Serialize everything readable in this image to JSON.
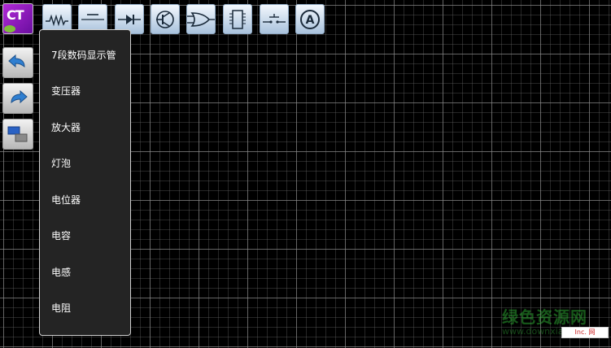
{
  "app": {
    "logo_text": "CT"
  },
  "sidebar": {
    "buttons": [
      {
        "icon": "undo-icon"
      },
      {
        "icon": "redo-icon"
      },
      {
        "icon": "layers-icon"
      }
    ]
  },
  "toolbar": {
    "tools": [
      {
        "icon": "resistor-icon"
      },
      {
        "icon": "capacitor-icon"
      },
      {
        "icon": "diode-icon"
      },
      {
        "icon": "transistor-icon"
      },
      {
        "icon": "or-gate-icon"
      },
      {
        "icon": "ic-chip-icon"
      },
      {
        "icon": "switch-icon"
      },
      {
        "icon": "ammeter-icon",
        "label": "A"
      }
    ]
  },
  "menu": {
    "items": [
      "7段数码显示管",
      "变压器",
      "放大器",
      "灯泡",
      "电位器",
      "电容",
      "电感",
      "电阻"
    ]
  },
  "watermark": {
    "text": "绿色资源网",
    "url": "www.downxia.com",
    "badge": "Inc. 网"
  },
  "colors": {
    "background": "#000000",
    "menu_bg": "#242424",
    "toolbar_button": "#c9dbee",
    "logo": "#9b1fc9",
    "watermark": "#34c43a"
  }
}
